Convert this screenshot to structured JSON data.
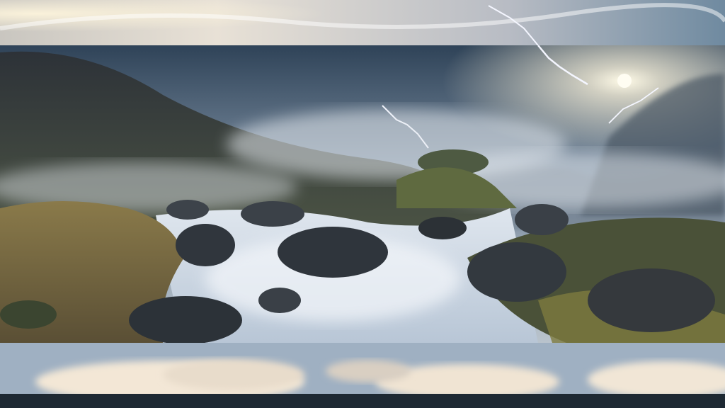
{
  "image": {
    "colors": {
      "sky": "#34465a",
      "mist": "#d8dee6",
      "water": "#e9eef4",
      "rock": "#3b4148",
      "grass": "#8a7a4a",
      "sun": "#fff7d6",
      "lightning": "#f4f6ff",
      "frame": "#1f2a33"
    }
  }
}
